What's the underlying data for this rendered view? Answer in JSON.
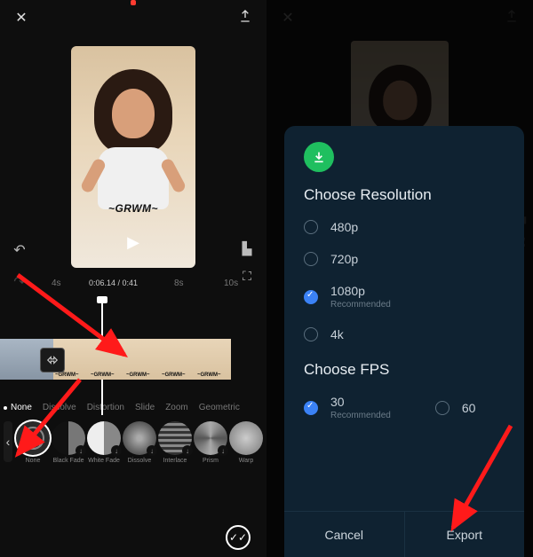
{
  "left": {
    "overlay_text": "~GRWM~",
    "timeline": {
      "mark_4s": "4s",
      "current": "0:06.14 / 0:41",
      "mark_8s": "8s",
      "mark_10s": "10s"
    },
    "clip_label": "~GRWM~",
    "categories": [
      "None",
      "Dissolve",
      "Distortion",
      "Slide",
      "Zoom",
      "Geometric"
    ],
    "effects": [
      "None",
      "Black Fade",
      "White Fade",
      "Dissolve",
      "Interlace",
      "Prism",
      "Warp"
    ]
  },
  "right": {
    "title_res": "Choose Resolution",
    "resolutions": [
      {
        "label": "480p",
        "checked": false
      },
      {
        "label": "720p",
        "checked": false
      },
      {
        "label": "1080p",
        "checked": true,
        "sub": "Recommended"
      },
      {
        "label": "4k",
        "checked": false
      }
    ],
    "title_fps": "Choose FPS",
    "fps": [
      {
        "label": "30",
        "checked": true,
        "sub": "Recommended"
      },
      {
        "label": "60",
        "checked": false
      }
    ],
    "cancel": "Cancel",
    "export": "Export"
  }
}
